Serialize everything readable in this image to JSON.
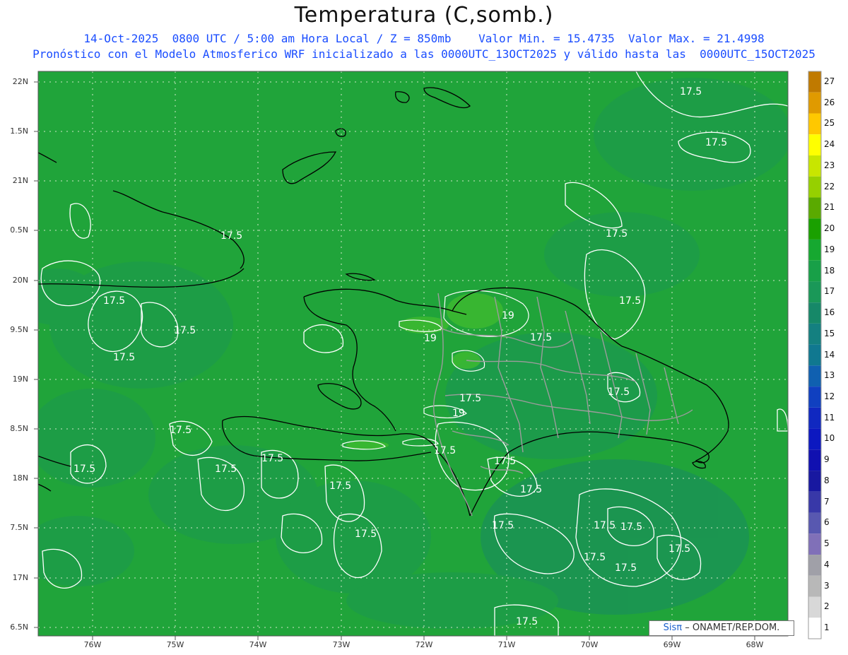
{
  "header": {
    "title": "Temperatura (C,somb.)",
    "line1": "14-Oct-2025  0800 UTC / 5:00 am Hora Local / Z = 850mb    Valor Min. = 15.4735  Valor Max. = 21.4998",
    "line2": "Pronóstico con el Modelo Atmosferico WRF inicializado a las 0000UTC_13OCT2025 y válido hasta las  0000UTC_15OCT2025"
  },
  "axes": {
    "lat_labels": [
      "22N",
      "1.5N",
      "21N",
      "0.5N",
      "20N",
      "9.5N",
      "19N",
      "8.5N",
      "18N",
      "7.5N",
      "17N",
      "6.5N"
    ],
    "lon_labels": [
      "76W",
      "75W",
      "74W",
      "73W",
      "72W",
      "71W",
      "70W",
      "69W",
      "68W"
    ]
  },
  "colorbar": {
    "labels": [
      "27",
      "26",
      "25",
      "24",
      "23",
      "22",
      "21",
      "20",
      "19",
      "18",
      "17",
      "16",
      "15",
      "14",
      "13",
      "12",
      "11",
      "10",
      "9",
      "8",
      "7",
      "6",
      "5",
      "4",
      "3",
      "2",
      "1"
    ],
    "colors": [
      "#c07a00",
      "#e09a00",
      "#ffc800",
      "#ffff00",
      "#c8e600",
      "#96d000",
      "#5aaa00",
      "#1aa000",
      "#16a830",
      "#18a048",
      "#1a9858",
      "#168868",
      "#148080",
      "#107890",
      "#1060b0",
      "#1040c0",
      "#1028c0",
      "#0c18c0",
      "#1010b0",
      "#1818a0",
      "#3838a8",
      "#5858b0",
      "#8070b8",
      "#a0a0a8",
      "#b8b8b8",
      "#d8d8d8",
      "#ffffff"
    ]
  },
  "map": {
    "contour_labels": [
      "17.5",
      "17.5",
      "17.5",
      "17.5",
      "17.5",
      "17.5",
      "17.5",
      "17.5",
      "17.5",
      "17.5",
      "17.5",
      "17.5",
      "17.5",
      "17.5",
      "17.5",
      "17.5",
      "17.5",
      "17.5",
      "17.5",
      "17.5",
      "17.5",
      "17.5",
      "17.5",
      "17.5",
      "19",
      "19",
      "19"
    ],
    "credit_sis": "Sisπ",
    "credit_rest": "– ONAMET/REP.DOM."
  }
}
